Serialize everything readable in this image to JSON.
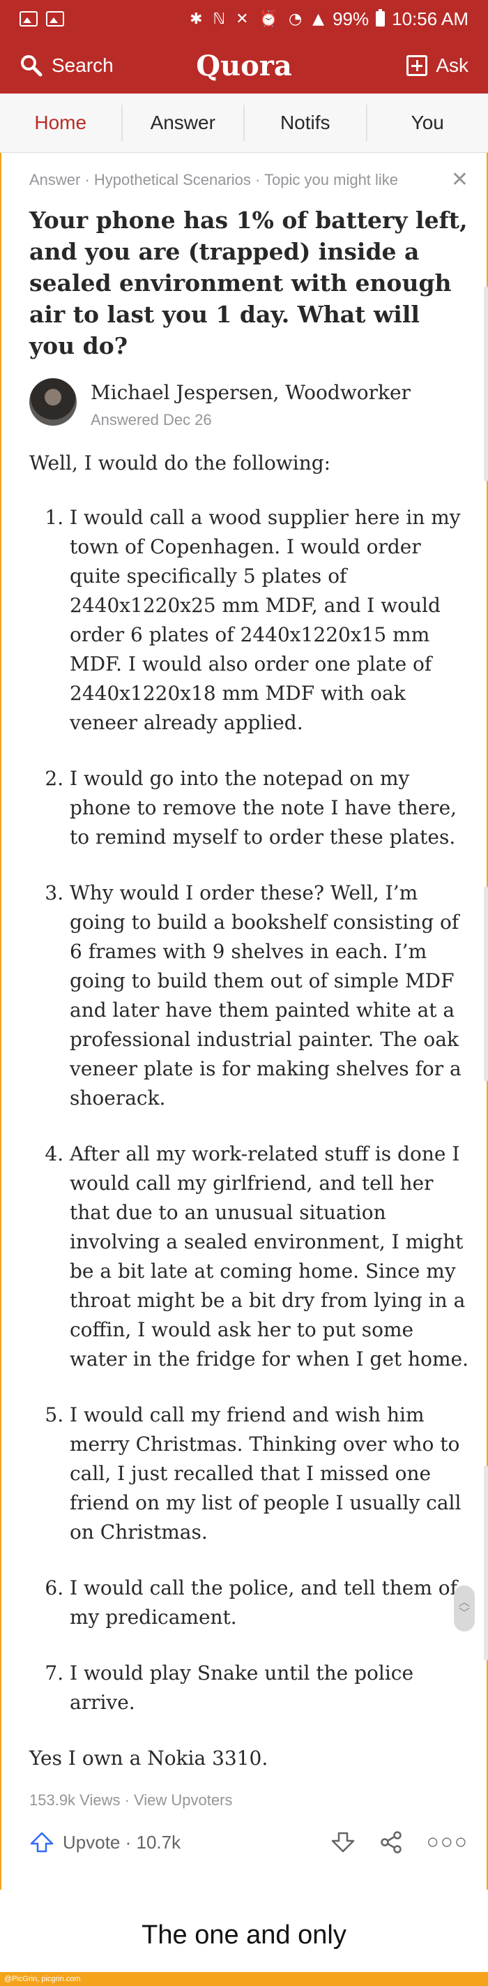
{
  "status_bar": {
    "battery": "99%",
    "time": "10:56 AM",
    "icons": [
      "image-icon",
      "image-icon",
      "bluetooth-icon",
      "nfc-icon",
      "mute-icon",
      "alarm-icon",
      "wifi-icon",
      "signal-icon",
      "battery-icon"
    ]
  },
  "app_bar": {
    "search_label": "Search",
    "logo": "Quora",
    "ask_label": "Ask",
    "brand_color": "#b92b27"
  },
  "tabs": [
    {
      "label": "Home",
      "active": true
    },
    {
      "label": "Answer",
      "active": false
    },
    {
      "label": "Notifs",
      "active": false
    },
    {
      "label": "You",
      "active": false
    }
  ],
  "card": {
    "breadcrumb": "Answer · Hypothetical Scenarios · Topic you might like",
    "question": "Your phone has 1% of battery left, and you are (trapped) inside a sealed environment with enough air to last you 1 day. What will you do?",
    "author": {
      "name": "Michael Jespersen, Woodworker",
      "answered": "Answered Dec 26"
    },
    "intro": "Well, I would do the following:",
    "items": [
      "I would call a wood supplier here in my town of Copenhagen. I would order quite specifically 5 plates of 2440x1220x25 mm MDF, and I would order 6 plates of 2440x1220x15 mm MDF. I would also order one plate of 2440x1220x18 mm MDF with oak veneer already applied.",
      "I would go into the notepad on my phone to remove the note I have there, to remind myself to order these plates.",
      "Why would I order these? Well, I’m going to build a bookshelf consisting of 6 frames with 9 shelves in each. I’m going to build them out of simple MDF and later have them painted white at a professional industrial painter. The oak veneer plate is for making shelves for a shoerack.",
      "After all my work-related stuff is done I would call my girlfriend, and tell her that due to an unusual situation involving a sealed environment, I might be a bit late at coming home. Since my throat might be a bit dry from lying in a coffin, I would ask her to put some water in the fridge for when I get home.",
      "I would call my friend and wish him merry Christmas. Thinking over who to call, I just recalled that I missed one friend on my list of people I usually call on Christmas.",
      "I would call the police, and tell them of my predicament.",
      "I would play Snake until the police arrive."
    ],
    "outro": "Yes I own a Nokia 3310.",
    "stats": "153.9k Views · View Upvoters",
    "upvote_label": "Upvote · 10.7k",
    "action_icons": [
      "upvote-icon",
      "downvote-icon",
      "share-icon",
      "more-icon"
    ]
  },
  "caption": "The one and only",
  "watermark": "@PicGrin, picgrin.com"
}
